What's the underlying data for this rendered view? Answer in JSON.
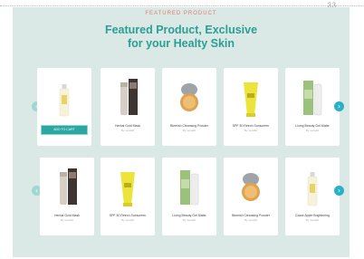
{
  "header": {
    "eyebrow": "FEATURED PRODUCT",
    "title_line1": "Featured Product, Exclusive",
    "title_line2": "for your Healty Skin",
    "corner_mark": "ვვ"
  },
  "colors": {
    "panel_bg": "#dbe9e6",
    "accent_teal": "#2a9f93",
    "eyebrow_color": "#e07a6f",
    "cart_button": "#2aa7a0",
    "next_arrow": "#27b2c9",
    "prev_arrow": "#9fd7d2"
  },
  "carousel_1": {
    "prev_icon": "‹",
    "next_icon": "›",
    "products": [
      {
        "name": "",
        "by": "",
        "icon": "pump-bottle-icon",
        "hover": true,
        "button_label": "ADD TO CART"
      },
      {
        "name": "Herbal Gold Mask",
        "by": "By ueoabit",
        "icon": "tube-with-box-icon"
      },
      {
        "name": "Blemish Cleansing Powder",
        "by": "By ueoabit",
        "icon": "compact-powder-icon"
      },
      {
        "name": "SPF 50 Reech Sunscreen",
        "by": "By ueoabit",
        "icon": "sunscreen-tube-icon"
      },
      {
        "name": "Living Beauty Gel Matte",
        "by": "By ueoabit",
        "icon": "tube-and-box-green-icon"
      }
    ]
  },
  "carousel_2": {
    "prev_icon": "‹",
    "next_icon": "›",
    "products": [
      {
        "name": "Herbal Gold Mask",
        "by": "By ueoabit",
        "icon": "tube-with-box-icon"
      },
      {
        "name": "SPF 50 Reech Sunscreen",
        "by": "By ueoabit",
        "icon": "sunscreen-tube-icon"
      },
      {
        "name": "Living Beauty Gel Matte",
        "by": "By ueoabit",
        "icon": "tube-and-box-green-icon"
      },
      {
        "name": "Blemish Cleansing Powder",
        "by": "By ueoabit",
        "icon": "compact-powder-icon"
      },
      {
        "name": "Grace Apple Brightening",
        "by": "By ueoabit",
        "icon": "pump-bottle-icon"
      }
    ]
  }
}
